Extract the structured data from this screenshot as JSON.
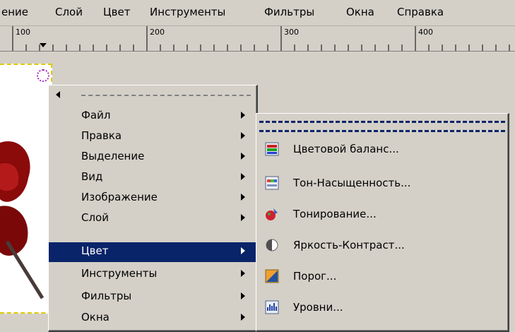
{
  "menubar": {
    "items": [
      "ение",
      "Слой",
      "Цвет",
      "Инструменты",
      "Фильтры",
      "Окна",
      "Справка"
    ]
  },
  "ruler": {
    "labels": [
      "100",
      "200",
      "300",
      "400"
    ]
  },
  "context_menu": {
    "items": [
      {
        "label": "Файл"
      },
      {
        "label": "Правка"
      },
      {
        "label": "Выделение"
      },
      {
        "label": "Вид"
      },
      {
        "label": "Изображение"
      },
      {
        "label": "Слой"
      },
      {
        "label": "Цвет",
        "selected": true
      },
      {
        "label": "Инструменты"
      },
      {
        "label": "Фильтры"
      },
      {
        "label": "Окна"
      }
    ]
  },
  "color_submenu": {
    "items": [
      {
        "label": "Цветовой баланс...",
        "icon": "color-balance-icon"
      },
      {
        "label": "Тон-Насыщенность...",
        "icon": "hue-saturation-icon"
      },
      {
        "label": "Тонирование...",
        "icon": "colorize-icon"
      },
      {
        "label": "Яркость-Контраст...",
        "icon": "brightness-contrast-icon"
      },
      {
        "label": "Порог...",
        "icon": "threshold-icon"
      },
      {
        "label": "Уровни...",
        "icon": "levels-icon"
      }
    ]
  },
  "colors": {
    "selection": "#0a246a",
    "menu_bg": "#d4d0c8",
    "submenu_tearoff": "#0a246a"
  }
}
